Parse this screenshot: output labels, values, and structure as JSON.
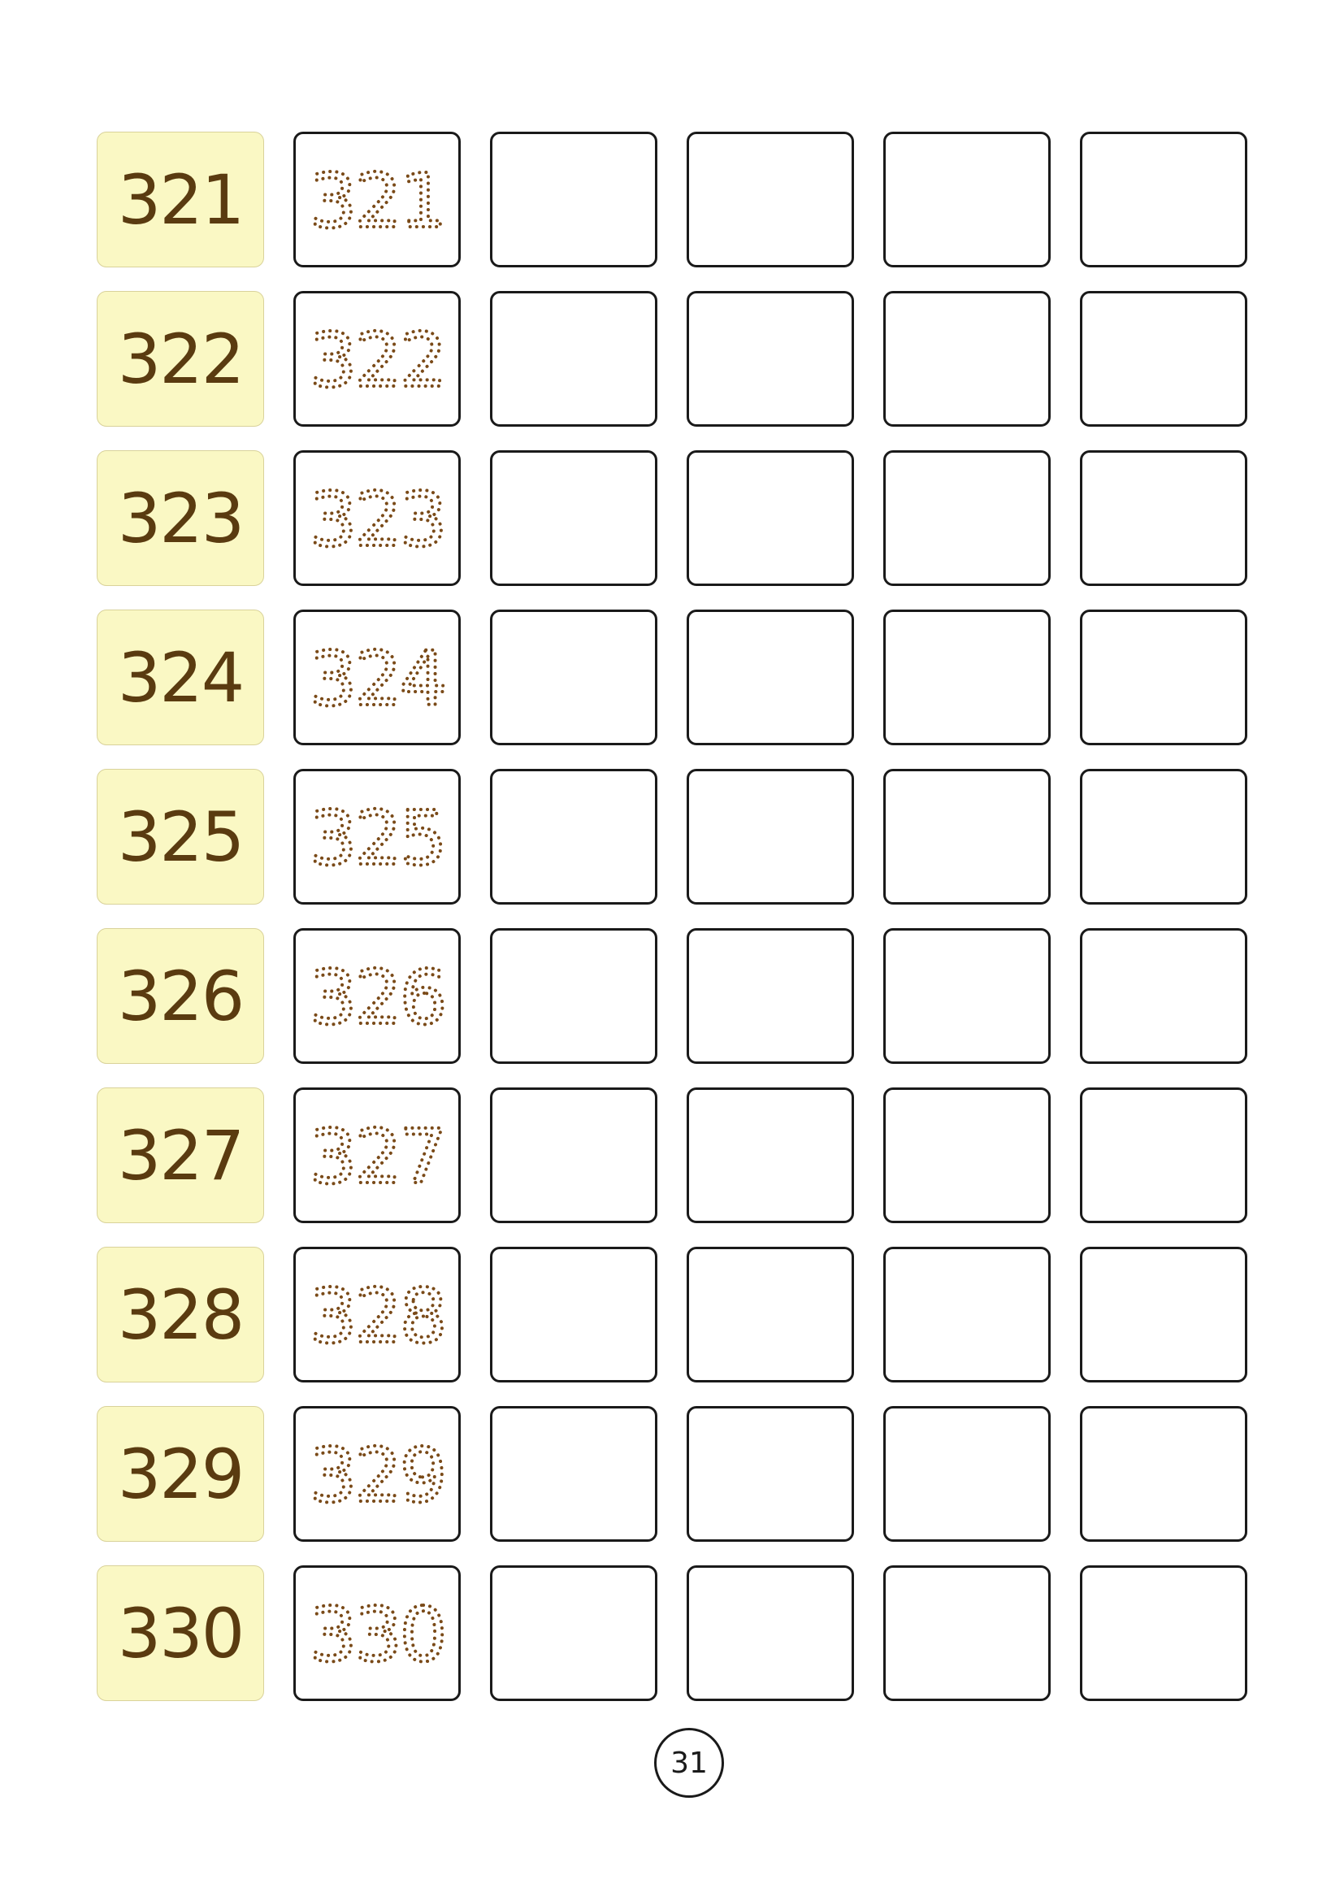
{
  "worksheet": {
    "practice_boxes_per_row": 4,
    "rows": [
      {
        "model": "321",
        "trace": "321"
      },
      {
        "model": "322",
        "trace": "322"
      },
      {
        "model": "323",
        "trace": "323"
      },
      {
        "model": "324",
        "trace": "324"
      },
      {
        "model": "325",
        "trace": "325"
      },
      {
        "model": "326",
        "trace": "326"
      },
      {
        "model": "327",
        "trace": "327"
      },
      {
        "model": "328",
        "trace": "328"
      },
      {
        "model": "329",
        "trace": "329"
      },
      {
        "model": "330",
        "trace": "330"
      }
    ]
  },
  "page": {
    "number": "31"
  },
  "colors": {
    "model_background": "#faf8c4",
    "number_color": "#5a3b10",
    "trace_dots": "#7a4a18",
    "box_border": "#1a1a1a"
  }
}
